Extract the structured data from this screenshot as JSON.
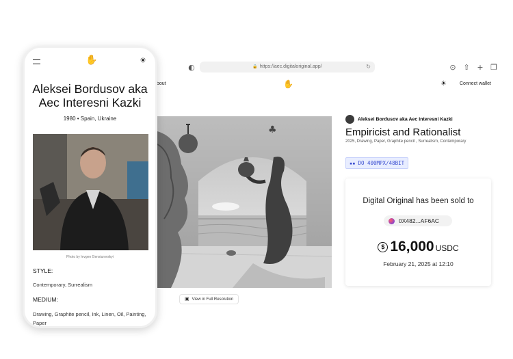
{
  "browser": {
    "url": "https://aec.digitaloriginal.app/",
    "lock_icon": "lock-icon",
    "reload_icon": "reload-icon"
  },
  "site_nav": {
    "about": "bout",
    "logo_icon": "hand-logo-icon",
    "theme_icon": "sun-icon",
    "connect": "Connect wallet"
  },
  "artwork": {
    "view_full": "View in Full Resolution",
    "artist": "Aleksei Bordusov aka Aec Interesni Kazki",
    "title": "Empiricist and Rationalist",
    "meta": "2025, Drawing, Paper, Graphite pencil , Surrealism, Contemporary",
    "badge": "DO 400MPX/48BIT"
  },
  "sale": {
    "sold_text": "Digital Original has been sold to",
    "wallet": "0X482...AF6AC",
    "currency_icon": "$",
    "price": "16,000",
    "currency": "USDC",
    "date": "February 21, 2025 at 12:10"
  },
  "phone": {
    "artist_name": "Aleksei Bordusov aka Aec Interesni Kazki",
    "bio": "1980  •  Spain, Ukraine",
    "photo_credit": "Photo by Ievgen Gensiurovskyi",
    "style_label": "STYLE:",
    "style_value": "Contemporary, Surrealism",
    "medium_label": "MEDIUM:",
    "medium_value": "Drawing, Graphite pencil, Ink, Linen, Oil, Painting, Paper"
  },
  "colors": {
    "badge_bg": "#e8edff",
    "badge_text": "#3b4fd1"
  }
}
